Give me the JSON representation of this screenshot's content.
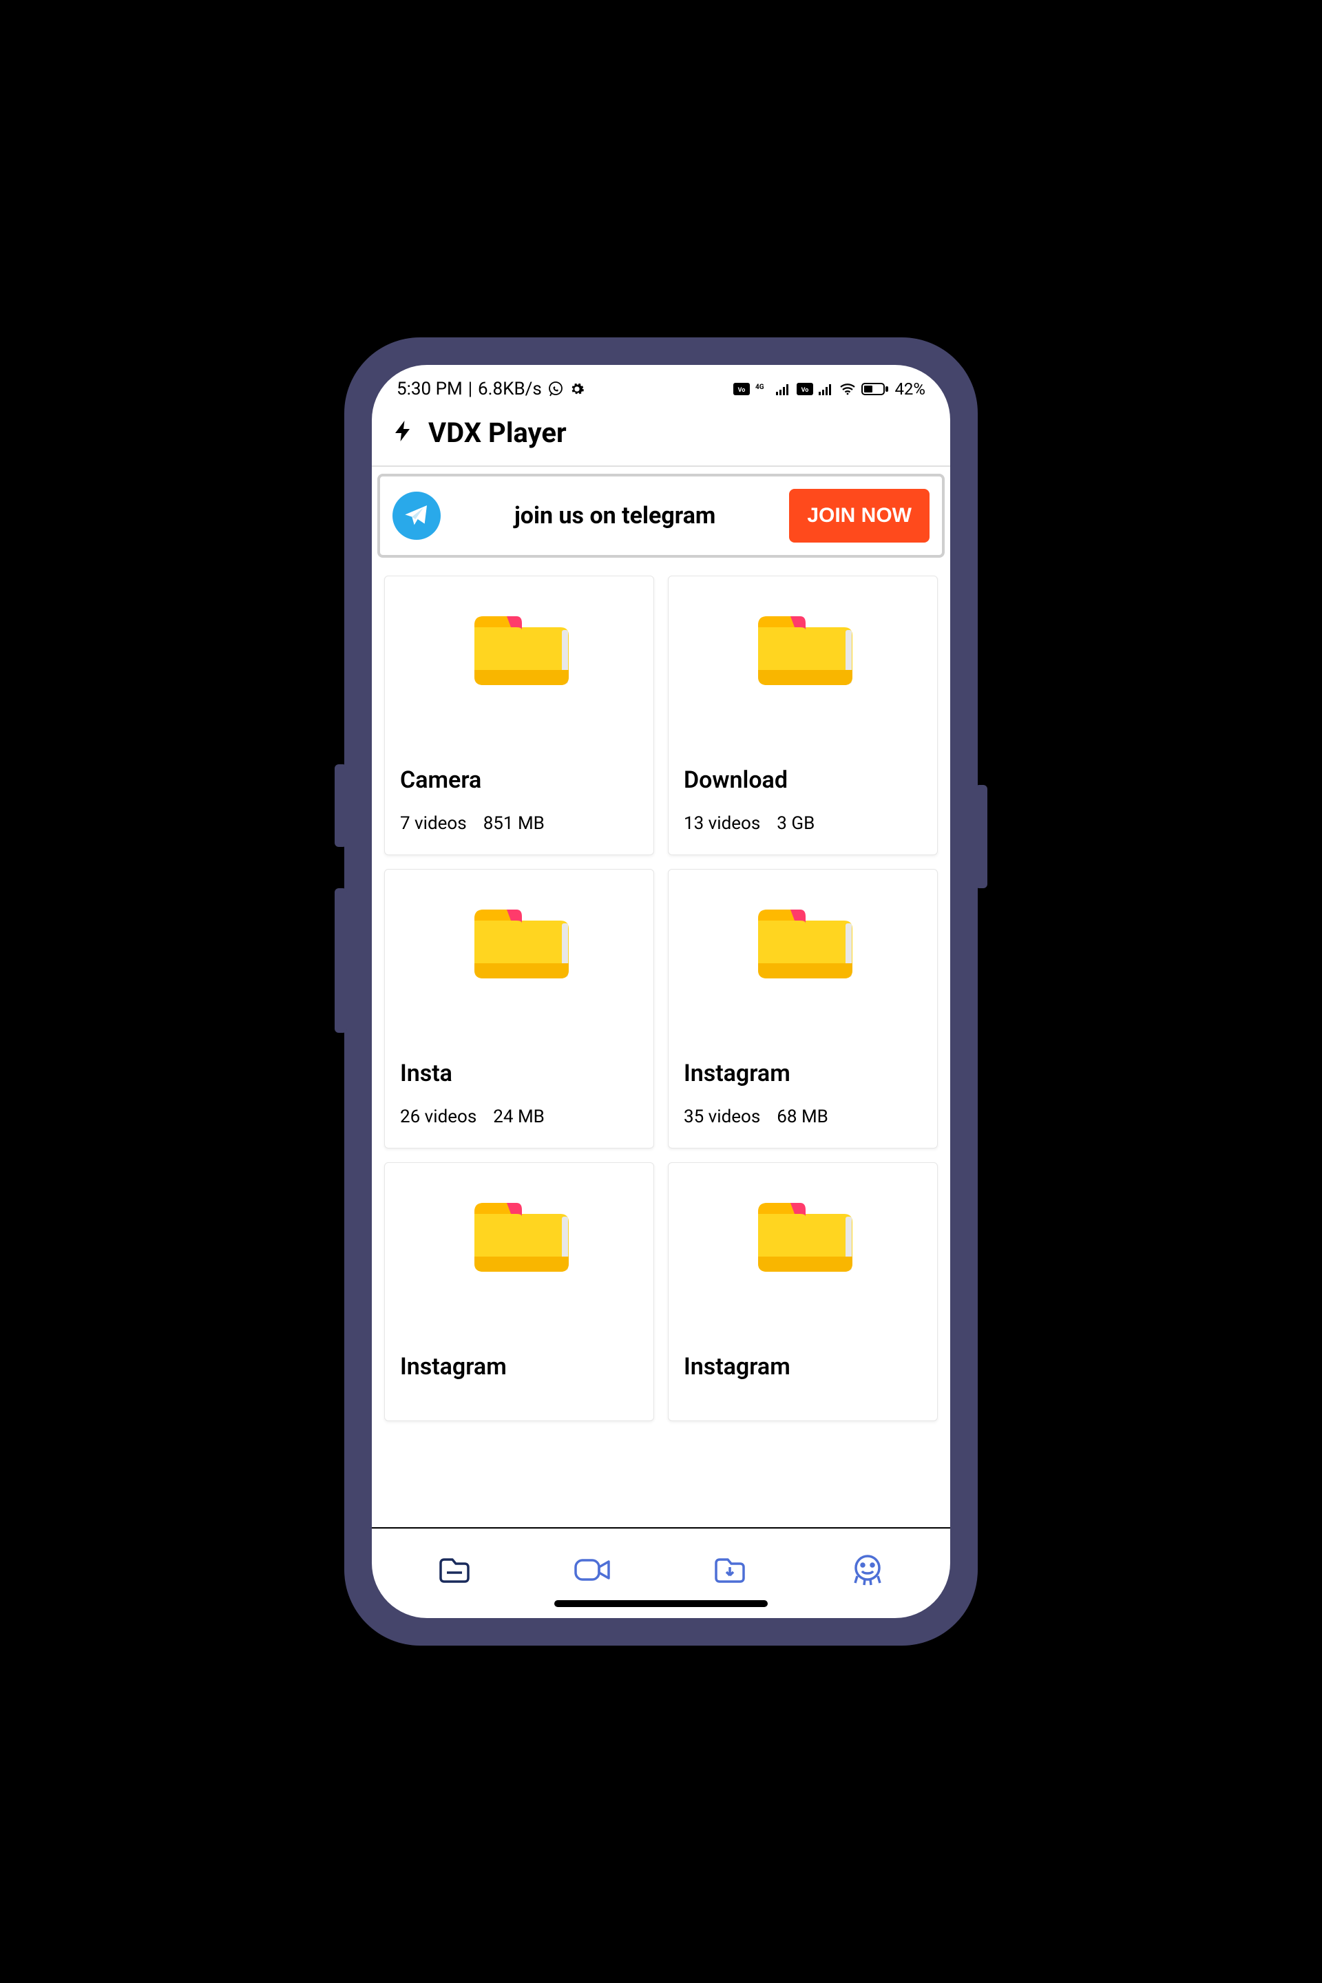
{
  "status": {
    "time": "5:30 PM",
    "net_speed": "6.8KB/s",
    "battery_pct": "42%"
  },
  "header": {
    "title": "VDX Player"
  },
  "banner": {
    "text": "join us on telegram",
    "button_label": "JOIN NOW"
  },
  "folders": [
    {
      "name": "Camera",
      "videos": "7 videos",
      "size": "851 MB"
    },
    {
      "name": "Download",
      "videos": "13 videos",
      "size": "3 GB"
    },
    {
      "name": "Insta",
      "videos": "26 videos",
      "size": "24 MB"
    },
    {
      "name": "Instagram",
      "videos": "35 videos",
      "size": "68 MB"
    },
    {
      "name": "Instagram",
      "videos": "",
      "size": ""
    },
    {
      "name": "Instagram",
      "videos": "",
      "size": ""
    }
  ],
  "nav": {
    "items": [
      "folders",
      "videos",
      "downloads",
      "settings"
    ]
  }
}
